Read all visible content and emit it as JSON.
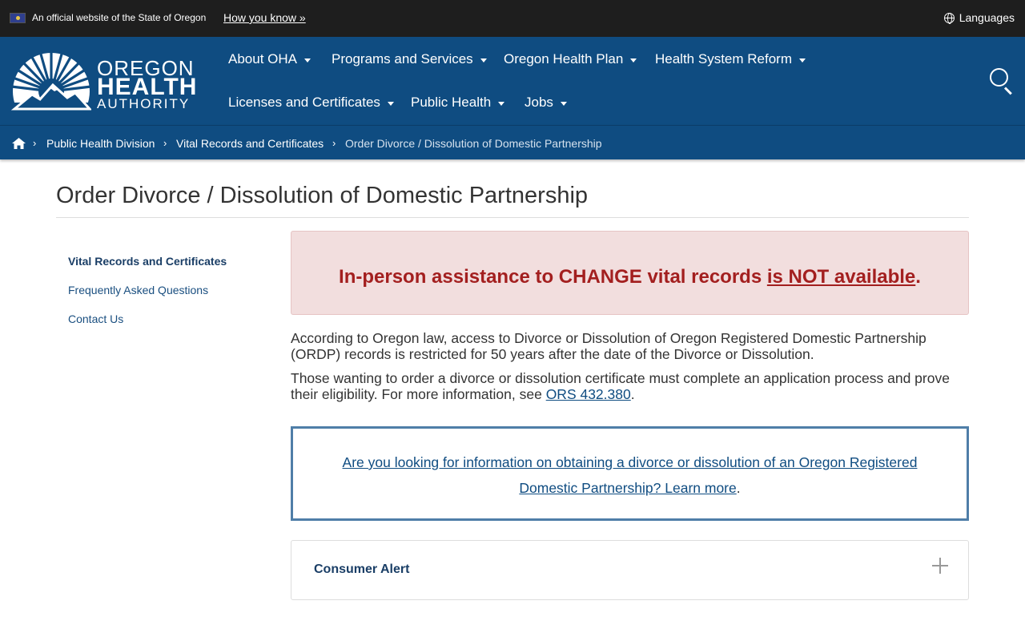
{
  "banner": {
    "official_text": "An official website of the State of Oregon",
    "how_you_know": "How you know »",
    "languages": "Languages"
  },
  "logo": {
    "line1": "OREGON",
    "line2": "HEALTH",
    "line3": "AUTHORITY"
  },
  "nav": {
    "items": [
      {
        "label": "About OHA"
      },
      {
        "label": "Programs and Services"
      },
      {
        "label": "Oregon Health Plan"
      },
      {
        "label": "Health System Reform"
      },
      {
        "label": "Licenses and Certificates"
      },
      {
        "label": "Public Health"
      },
      {
        "label": "Jobs"
      }
    ]
  },
  "breadcrumb": {
    "items": [
      "Public Health Division",
      "Vital Records and Certificates",
      "Order Divorce / Dissolution of Domestic Partnership"
    ]
  },
  "page": {
    "title": "Order Divorce / Dissolution of Domestic Partnership"
  },
  "sidebar": {
    "items": [
      {
        "label": "Vital Records and Certificates",
        "active": true
      },
      {
        "label": "Frequently Asked Questions",
        "active": false
      },
      {
        "label": "Contact Us",
        "active": false
      }
    ]
  },
  "alert": {
    "text_before": "In-person assistance to CHANGE vital records ",
    "link_text": "is NOT available",
    "text_after": "."
  },
  "content": {
    "para1": "According to Oregon law, access to Divorce or Dissolution of Oregon Registered Domestic Partnership (ORDP) records is restricted for 50 years after the date of the Divorce or Dissolution.",
    "para2_before": "Those wanting to order a divorce or dissolution certificate must complete an application process and prove their eligibility. For more information, see ",
    "para2_link": "ORS 432.380",
    "para2_after": "."
  },
  "infobox": {
    "link_text": "Are you looking for information on obtaining a divorce or dissolution of an Oregon Registered Domestic Partnership? Learn more",
    "after": "."
  },
  "accordion": {
    "label": "Consumer Alert"
  },
  "colors": {
    "header_blue": "#0f4c81",
    "topbar": "#1e1e1e",
    "alert_bg": "#f2dede",
    "alert_text": "#a31f1f",
    "infobox_border": "#4f7ea8"
  },
  "icons": [
    "flag-icon",
    "globe-icon",
    "search-icon",
    "home-icon",
    "chevron-right-icon",
    "caret-down-icon",
    "plus-icon"
  ]
}
